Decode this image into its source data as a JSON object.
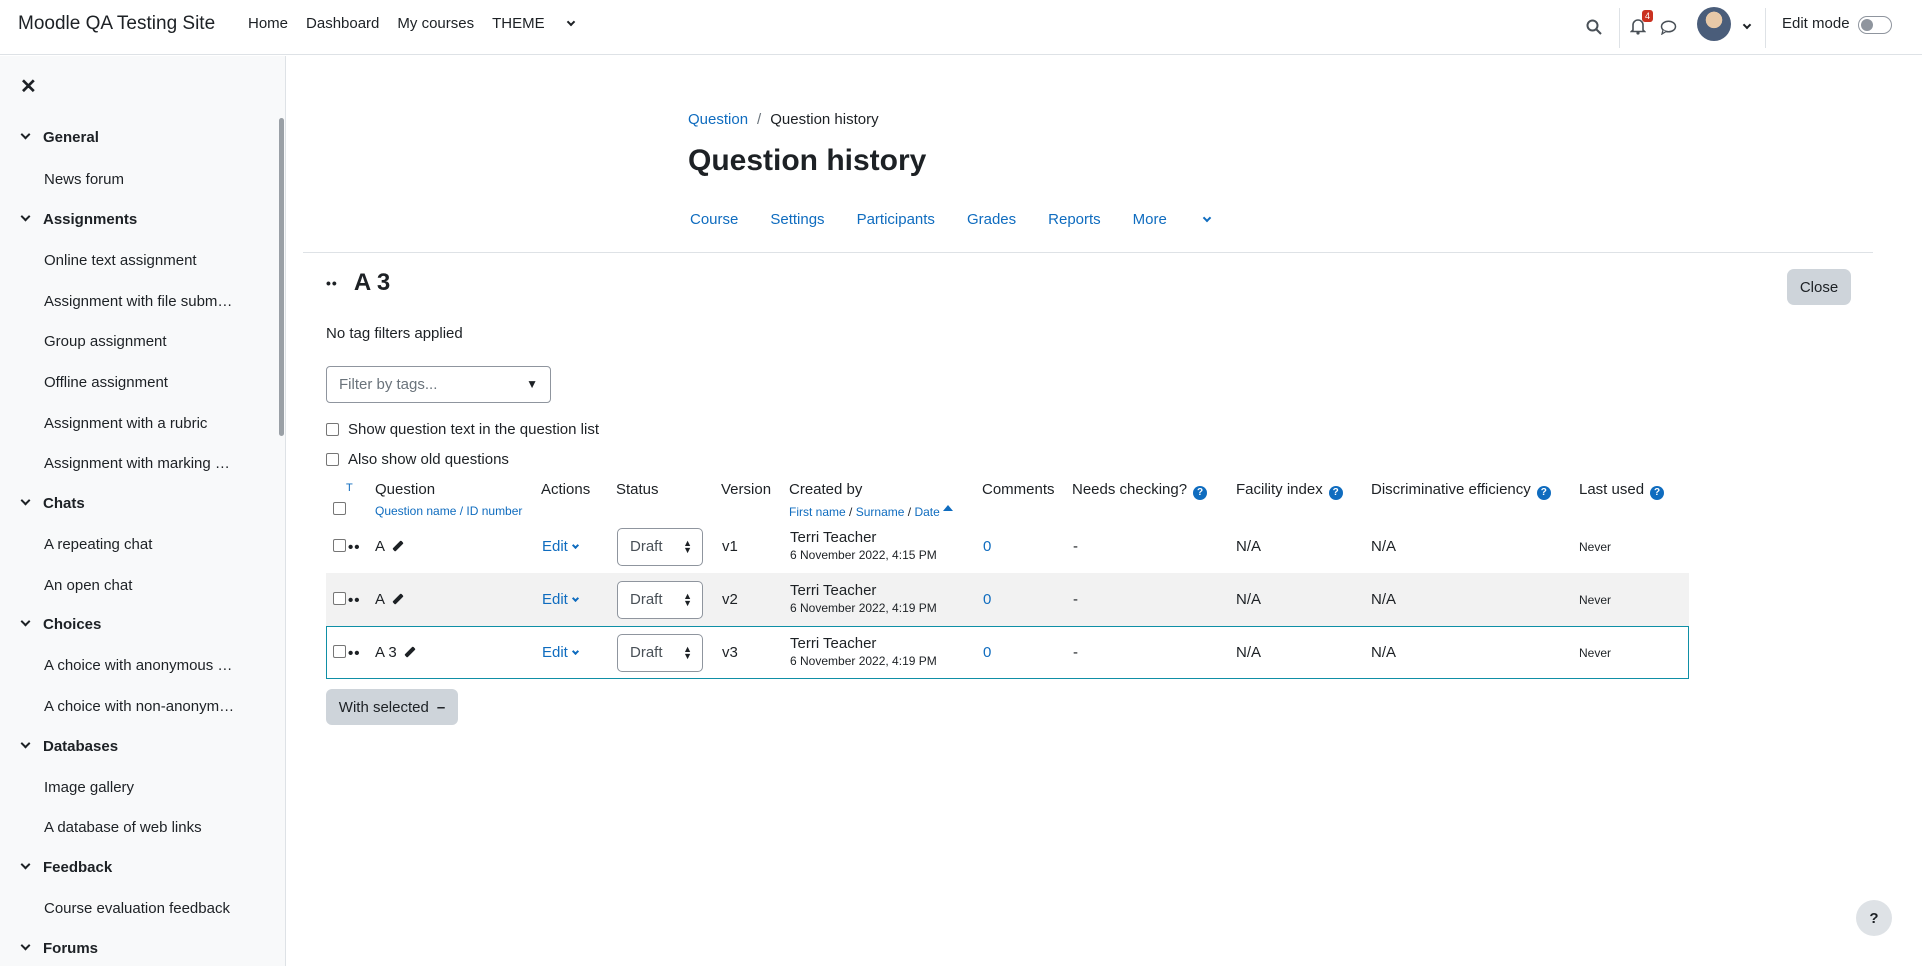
{
  "navbar": {
    "site_name": "Moodle QA Testing Site",
    "links": [
      "Home",
      "Dashboard",
      "My courses",
      "THEME"
    ],
    "notification_count": "4",
    "edit_mode_label": "Edit mode"
  },
  "drawer": {
    "sections": [
      {
        "title": "General",
        "items": [
          "News forum"
        ]
      },
      {
        "title": "Assignments",
        "items": [
          "Online text assignment",
          "Assignment with file subm…",
          "Group assignment",
          "Offline assignment",
          "Assignment with a rubric",
          "Assignment with marking …"
        ]
      },
      {
        "title": "Chats",
        "items": [
          "A repeating chat",
          "An open chat"
        ]
      },
      {
        "title": "Choices",
        "items": [
          "A choice with anonymous …",
          "A choice with non-anonym…"
        ]
      },
      {
        "title": "Databases",
        "items": [
          "Image gallery",
          "A database of web links"
        ]
      },
      {
        "title": "Feedback",
        "items": [
          "Course evaluation feedback"
        ]
      },
      {
        "title": "Forums",
        "items": []
      }
    ]
  },
  "breadcrumb": {
    "parent": "Question",
    "current": "Question history"
  },
  "page_title": "Question history",
  "secondary_nav": [
    "Course",
    "Settings",
    "Participants",
    "Grades",
    "Reports",
    "More"
  ],
  "question_heading": "A 3",
  "close_label": "Close",
  "no_tag_filters": "No tag filters applied",
  "tag_filter_placeholder": "Filter by tags...",
  "options": {
    "show_text": "Show question text in the question list",
    "show_old": "Also show old questions"
  },
  "table": {
    "headers": {
      "t": "T",
      "question": "Question",
      "question_sub": "Question name / ID number",
      "actions": "Actions",
      "status": "Status",
      "version": "Version",
      "created_by": "Created by",
      "created_sub_first": "First name",
      "created_sub_surname": "Surname",
      "created_sub_date": "Date",
      "comments": "Comments",
      "needs_checking": "Needs checking?",
      "facility": "Facility index",
      "discriminative": "Discriminative efficiency",
      "last_used": "Last used"
    },
    "rows": [
      {
        "name": "A",
        "action": "Edit",
        "status": "Draft",
        "version": "v1",
        "author": "Terri Teacher",
        "date": "6 November 2022, 4:15 PM",
        "comments": "0",
        "needs_checking": "-",
        "facility": "N/A",
        "discriminative": "N/A",
        "last_used": "Never"
      },
      {
        "name": "A",
        "action": "Edit",
        "status": "Draft",
        "version": "v2",
        "author": "Terri Teacher",
        "date": "6 November 2022, 4:19 PM",
        "comments": "0",
        "needs_checking": "-",
        "facility": "N/A",
        "discriminative": "N/A",
        "last_used": "Never"
      },
      {
        "name": "A 3",
        "action": "Edit",
        "status": "Draft",
        "version": "v3",
        "author": "Terri Teacher",
        "date": "6 November 2022, 4:19 PM",
        "comments": "0",
        "needs_checking": "-",
        "facility": "N/A",
        "discriminative": "N/A",
        "last_used": "Never"
      }
    ]
  },
  "with_selected_label": "With selected",
  "help_label": "?"
}
